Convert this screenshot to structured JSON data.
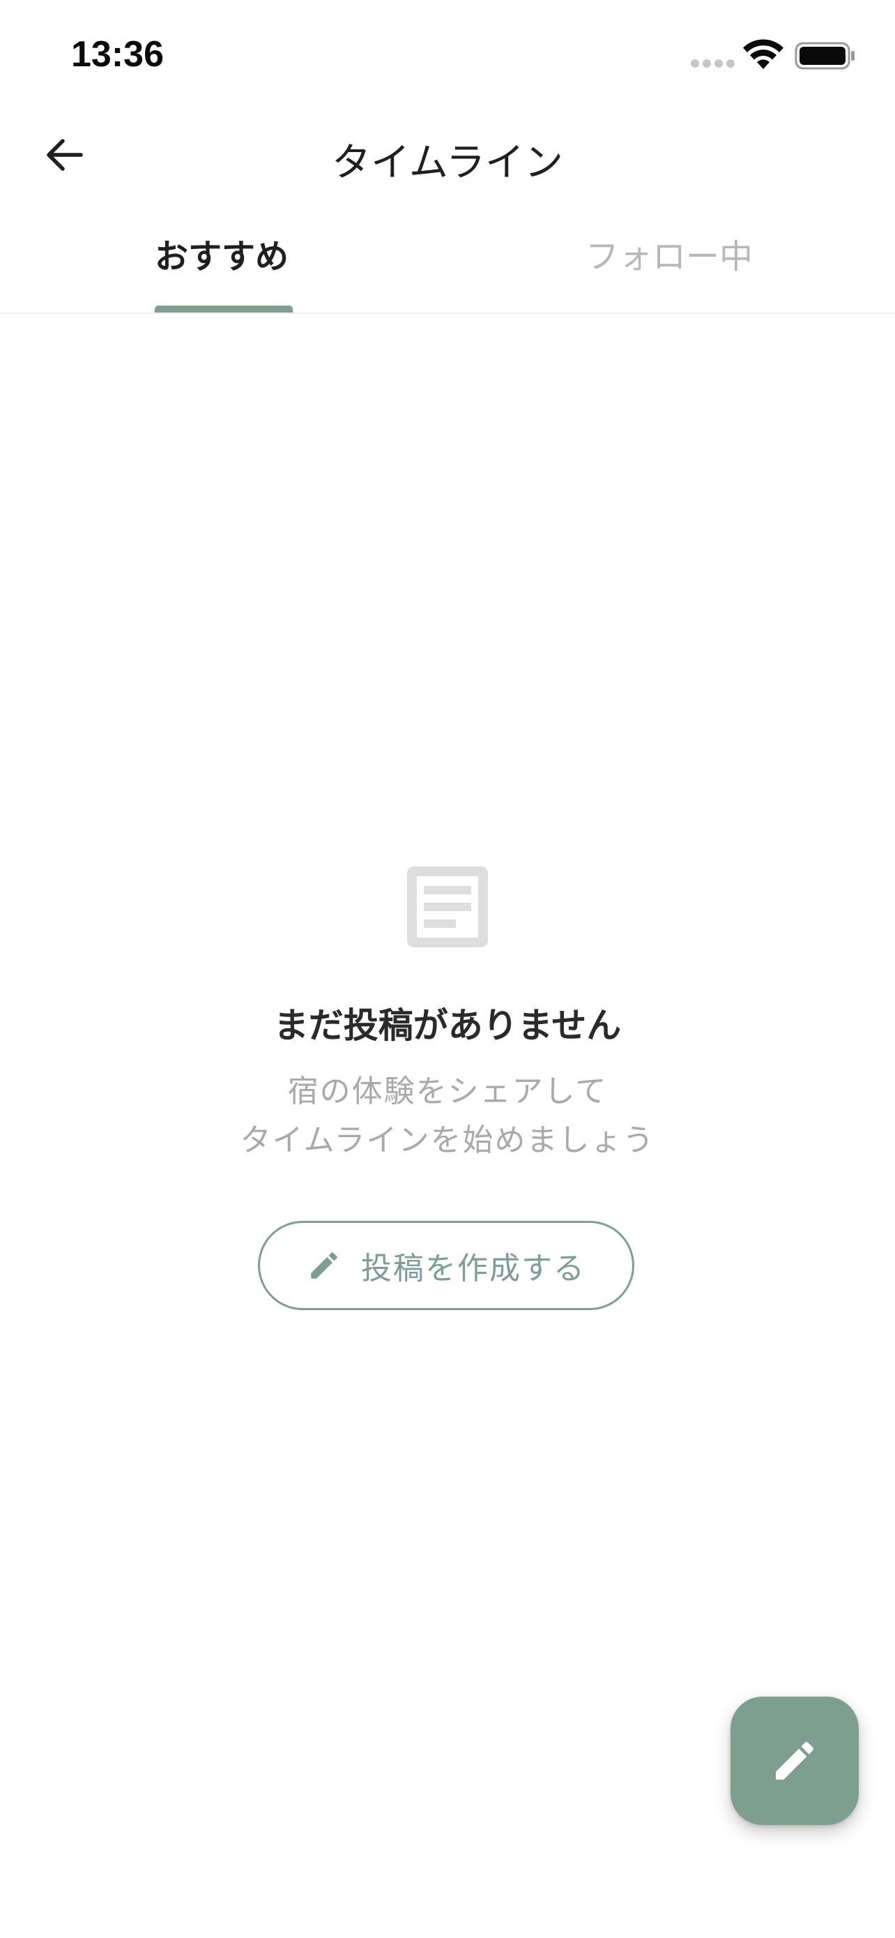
{
  "status_bar": {
    "time": "13:36"
  },
  "header": {
    "title": "タイムライン",
    "back_icon": "arrow-left-icon"
  },
  "tabs": [
    {
      "label": "おすすめ",
      "active": true
    },
    {
      "label": "フォロー中",
      "active": false
    }
  ],
  "empty_state": {
    "icon": "document-icon",
    "title": "まだ投稿がありません",
    "description_line1": "宿の体験をシェアして",
    "description_line2": "タイムラインを始めましょう",
    "button_label": "投稿を作成する",
    "button_icon": "pencil-icon"
  },
  "fab": {
    "icon": "pencil-icon"
  },
  "colors": {
    "accent": "#7f9e92",
    "text_primary": "#1f1f1f",
    "text_muted": "#a9a9a9",
    "tab_inactive": "#b8b8b8",
    "divider": "#ededed",
    "icon_gray": "#dedede"
  }
}
